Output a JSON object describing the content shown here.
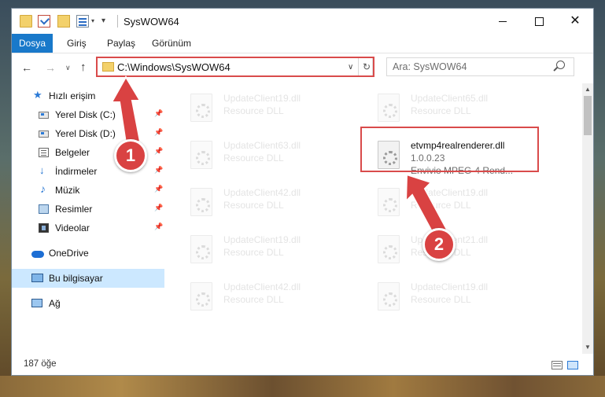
{
  "window": {
    "title": "SysWOW64",
    "qa_dropdown": "▾",
    "qa_customize": "▾",
    "close_glyph": "✕"
  },
  "ribbon": {
    "tabs": [
      {
        "label": "Dosya"
      },
      {
        "label": "Giriş"
      },
      {
        "label": "Paylaş"
      },
      {
        "label": "Görünüm"
      }
    ],
    "help": "?",
    "collapse": "∨"
  },
  "navigation": {
    "back": "←",
    "forward": "→",
    "recent": "∨",
    "up": "↑",
    "address": "C:\\Windows\\SysWOW64",
    "address_chevron": "∨",
    "refresh": "↻",
    "search_placeholder": "Ara: SysWOW64"
  },
  "sidebar": {
    "items": [
      {
        "label": "Hızlı erişim",
        "icon": "star-icon"
      },
      {
        "label": "Yerel Disk (C:)",
        "icon": "disk-icon",
        "pinned": true
      },
      {
        "label": "Yerel Disk (D:)",
        "icon": "disk-icon",
        "pinned": true
      },
      {
        "label": "Belgeler",
        "icon": "documents-icon",
        "pinned": true
      },
      {
        "label": "İndirmeler",
        "icon": "download-icon",
        "pinned": true
      },
      {
        "label": "Müzik",
        "icon": "music-icon",
        "pinned": true
      },
      {
        "label": "Resimler",
        "icon": "pictures-icon",
        "pinned": true
      },
      {
        "label": "Videolar",
        "icon": "videos-icon",
        "pinned": true
      },
      {
        "label": "OneDrive",
        "icon": "onedrive-icon"
      },
      {
        "label": "Bu bilgisayar",
        "icon": "computer-icon",
        "selected": true
      },
      {
        "label": "Ağ",
        "icon": "network-icon"
      }
    ],
    "pin_glyph": "📌"
  },
  "files": [
    {
      "name": "UpdateClient19.dll",
      "type": "Resource DLL"
    },
    {
      "name": "UpdateClient65.dll",
      "type": "Resource DLL"
    },
    {
      "name": "UpdateClient63.dll",
      "type": "Resource DLL"
    },
    {
      "name": "etvmp4realrenderer.dll",
      "version": "1.0.0.23",
      "description": "Envivio MPEG-4 Rend...",
      "selected": true
    },
    {
      "name": "UpdateClient42.dll",
      "type": "Resource DLL"
    },
    {
      "name": "UpdateClient19.dll",
      "type": "Resource DLL"
    },
    {
      "name": "UpdateClient19.dll",
      "type": "Resource DLL"
    },
    {
      "name": "UpdateClient21.dll",
      "type": "Resource DLL"
    },
    {
      "name": "UpdateClient42.dll",
      "type": "Resource DLL"
    },
    {
      "name": "UpdateClient19.dll",
      "type": "Resource DLL"
    }
  ],
  "status": {
    "item_count": "187 öğe"
  },
  "annotations": {
    "step1": "1",
    "step2": "2",
    "color": "#d94242"
  },
  "colors": {
    "accent": "#1979ca",
    "selection": "#cce8ff",
    "highlight_border": "#d94b4b"
  }
}
